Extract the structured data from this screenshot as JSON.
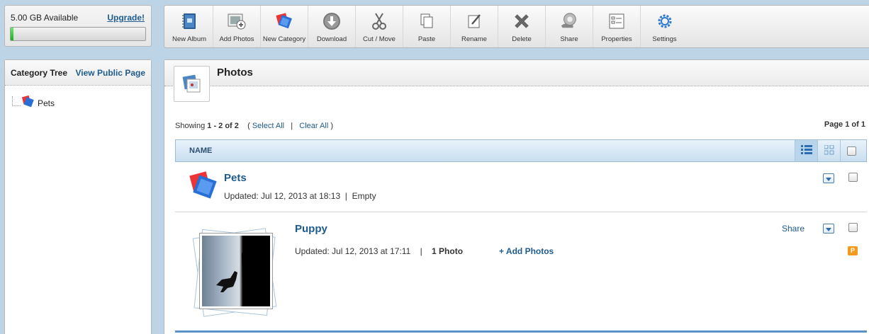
{
  "storage": {
    "available": "5.00 GB Available",
    "upgrade_label": "Upgrade!",
    "used_fraction": 0.02
  },
  "toolbar": {
    "buttons": [
      {
        "label": "New Album",
        "icon": "album-icon"
      },
      {
        "label": "Add Photos",
        "icon": "add-photos-icon"
      },
      {
        "label": "New Category",
        "icon": "category-icon"
      },
      {
        "label": "Download",
        "icon": "download-icon"
      },
      {
        "label": "Cut / Move",
        "icon": "scissors-icon"
      },
      {
        "label": "Paste",
        "icon": "paste-icon"
      },
      {
        "label": "Rename",
        "icon": "pencil-icon"
      },
      {
        "label": "Delete",
        "icon": "delete-icon"
      },
      {
        "label": "Share",
        "icon": "share-icon"
      },
      {
        "label": "Properties",
        "icon": "properties-icon"
      },
      {
        "label": "Settings",
        "icon": "gear-icon"
      }
    ]
  },
  "sidebar": {
    "title": "Category Tree",
    "public_link": "View Public Page",
    "tree": [
      {
        "label": "Pets"
      }
    ]
  },
  "main": {
    "title": "Photos",
    "showing_prefix": "Showing",
    "showing_range": "1 - 2 of 2",
    "select_all": "Select All",
    "clear_all": "Clear All",
    "page_prefix": "Page",
    "page_current": "1",
    "page_of": "of",
    "page_total": "1",
    "column_name": "NAME"
  },
  "items": [
    {
      "title": "Pets",
      "updated": "Updated: Jul 12, 2013 at 18:13",
      "status": "Empty"
    },
    {
      "title": "Puppy",
      "updated": "Updated: Jul 12, 2013 at 17:11",
      "count": "1 Photo",
      "add_photos": "Add Photos",
      "share": "Share",
      "badge": "P"
    }
  ],
  "colors": {
    "link": "#1e5b8e",
    "header_blue": "#c9dff0",
    "progress_green": "#19b419",
    "badge_orange": "#f39a1e"
  }
}
